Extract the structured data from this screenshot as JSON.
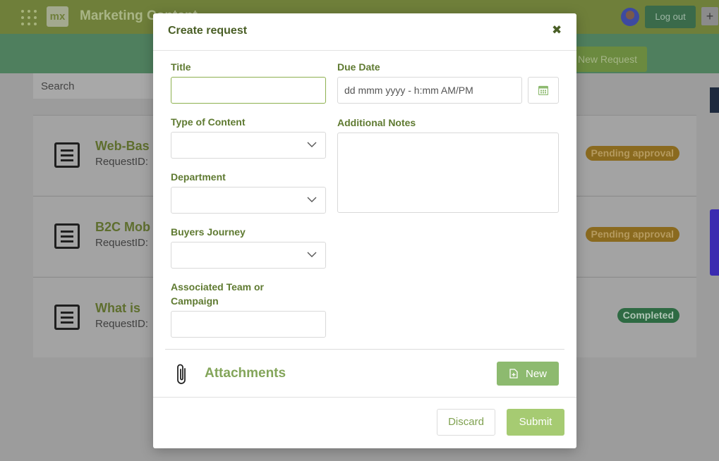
{
  "background": {
    "app_title": "Marketing Content",
    "logo_text": "mx",
    "logout_label": "Log out",
    "plus_label": "+",
    "new_request_label": "New Request",
    "search_placeholder": "Search",
    "cards": [
      {
        "title": "Web-Bas",
        "sub": "RequestID: ",
        "status": "Pending approval"
      },
      {
        "title": "B2C Mob",
        "sub": "RequestID: ",
        "status": "Pending approval"
      },
      {
        "title": "What is ",
        "sub": "RequestID: ",
        "status": "Completed"
      }
    ]
  },
  "modal": {
    "title": "Create request",
    "close_glyph": "✖",
    "fields": {
      "title_label": "Title",
      "title_value": "",
      "due_date_label": "Due Date",
      "due_date_placeholder": "dd mmm yyyy - h:mm AM/PM",
      "type_label": "Type of Content",
      "notes_label": "Additional Notes",
      "department_label": "Department",
      "journey_label": "Buyers Journey",
      "team_label_line1": "Associated Team or",
      "team_label_line2": "Campaign"
    },
    "attachments": {
      "title": "Attachments",
      "new_label": "New"
    },
    "footer": {
      "discard_label": "Discard",
      "submit_label": "Submit"
    }
  },
  "colors": {
    "label_green": "#5f7a31",
    "accent_green": "#8dba6f",
    "submit_green": "#a6cb72",
    "pending": "#8a6a1f",
    "completed": "#2e6a43"
  }
}
